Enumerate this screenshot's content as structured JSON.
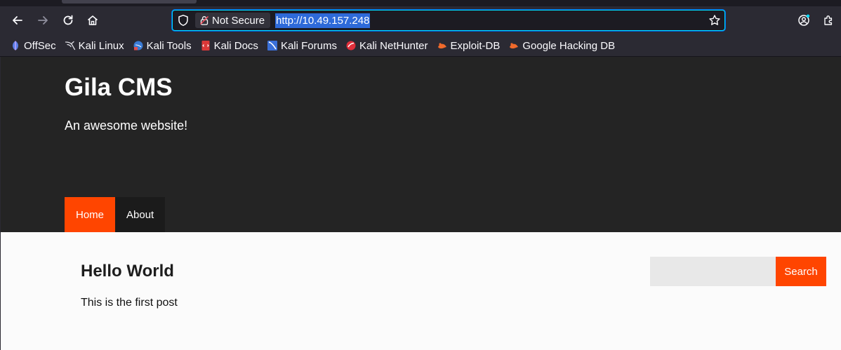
{
  "browser": {
    "security_label": "Not Secure",
    "url": "http://10.49.157.248",
    "accent_color": "#00ddff",
    "selection_color": "#2e6ad9",
    "bookmarks": [
      {
        "label": "OffSec",
        "icon": "offsec-icon"
      },
      {
        "label": "Kali Linux",
        "icon": "kali-dragon-icon"
      },
      {
        "label": "Kali Tools",
        "icon": "kali-tools-icon"
      },
      {
        "label": "Kali Docs",
        "icon": "kali-docs-icon"
      },
      {
        "label": "Kali Forums",
        "icon": "kali-forums-icon"
      },
      {
        "label": "Kali NetHunter",
        "icon": "nethunter-icon"
      },
      {
        "label": "Exploit-DB",
        "icon": "exploit-db-icon"
      },
      {
        "label": "Google Hacking DB",
        "icon": "ghdb-icon"
      }
    ]
  },
  "site": {
    "title": "Gila CMS",
    "tagline": "An awesome website!",
    "brand_color": "#ff4500",
    "menu": [
      {
        "label": "Home",
        "active": true
      },
      {
        "label": "About",
        "active": false
      }
    ]
  },
  "post": {
    "title": "Hello World",
    "body": "This is the first post"
  },
  "search": {
    "value": "",
    "placeholder": "",
    "button_label": "Search"
  }
}
